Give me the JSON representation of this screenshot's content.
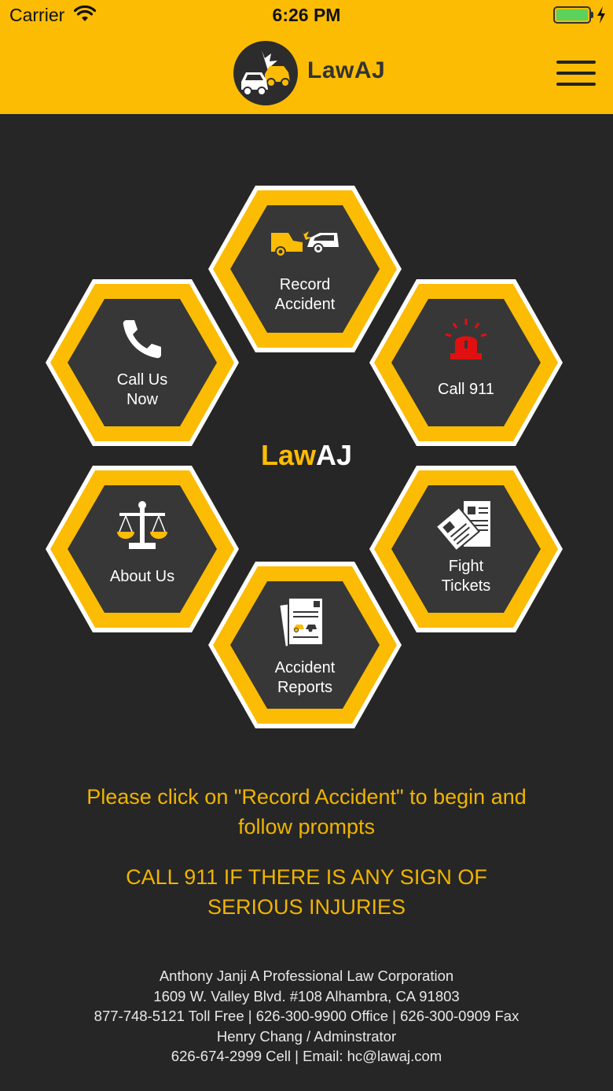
{
  "status_bar": {
    "carrier": "Carrier",
    "time": "6:26 PM"
  },
  "header": {
    "app_name": "LawAJ"
  },
  "hexagons": {
    "record_accident": {
      "line1": "Record",
      "line2": "Accident"
    },
    "call_us_now": {
      "line1": "Call Us",
      "line2": "Now"
    },
    "call_911": {
      "line1": "Call 911"
    },
    "about_us": {
      "line1": "About Us"
    },
    "fight_tickets": {
      "line1": "Fight",
      "line2": "Tickets"
    },
    "accident_reports": {
      "line1": "Accident",
      "line2": "Reports"
    }
  },
  "center_brand": {
    "law": "Law",
    "aj": "AJ"
  },
  "messages": {
    "prompt_line1": "Please click on \"Record Accident\" to begin and",
    "prompt_line2": "follow prompts",
    "warning_line1": "CALL 911 IF THERE IS ANY SIGN OF",
    "warning_line2": "SERIOUS INJURIES"
  },
  "footer": {
    "line1": "Anthony Janji A Professional Law Corporation",
    "line2": "1609 W. Valley Blvd. #108 Alhambra, CA 91803",
    "line3": "877-748-5121 Toll Free | 626-300-9900 Office | 626-300-0909 Fax",
    "line4": "Henry Chang / Adminstrator",
    "line5": "626-674-2999 Cell | Email: hc@lawaj.com"
  },
  "colors": {
    "accent": "#FCBC04",
    "background": "#262626",
    "hex_inner": "#373737",
    "alert_red": "#E01010"
  }
}
